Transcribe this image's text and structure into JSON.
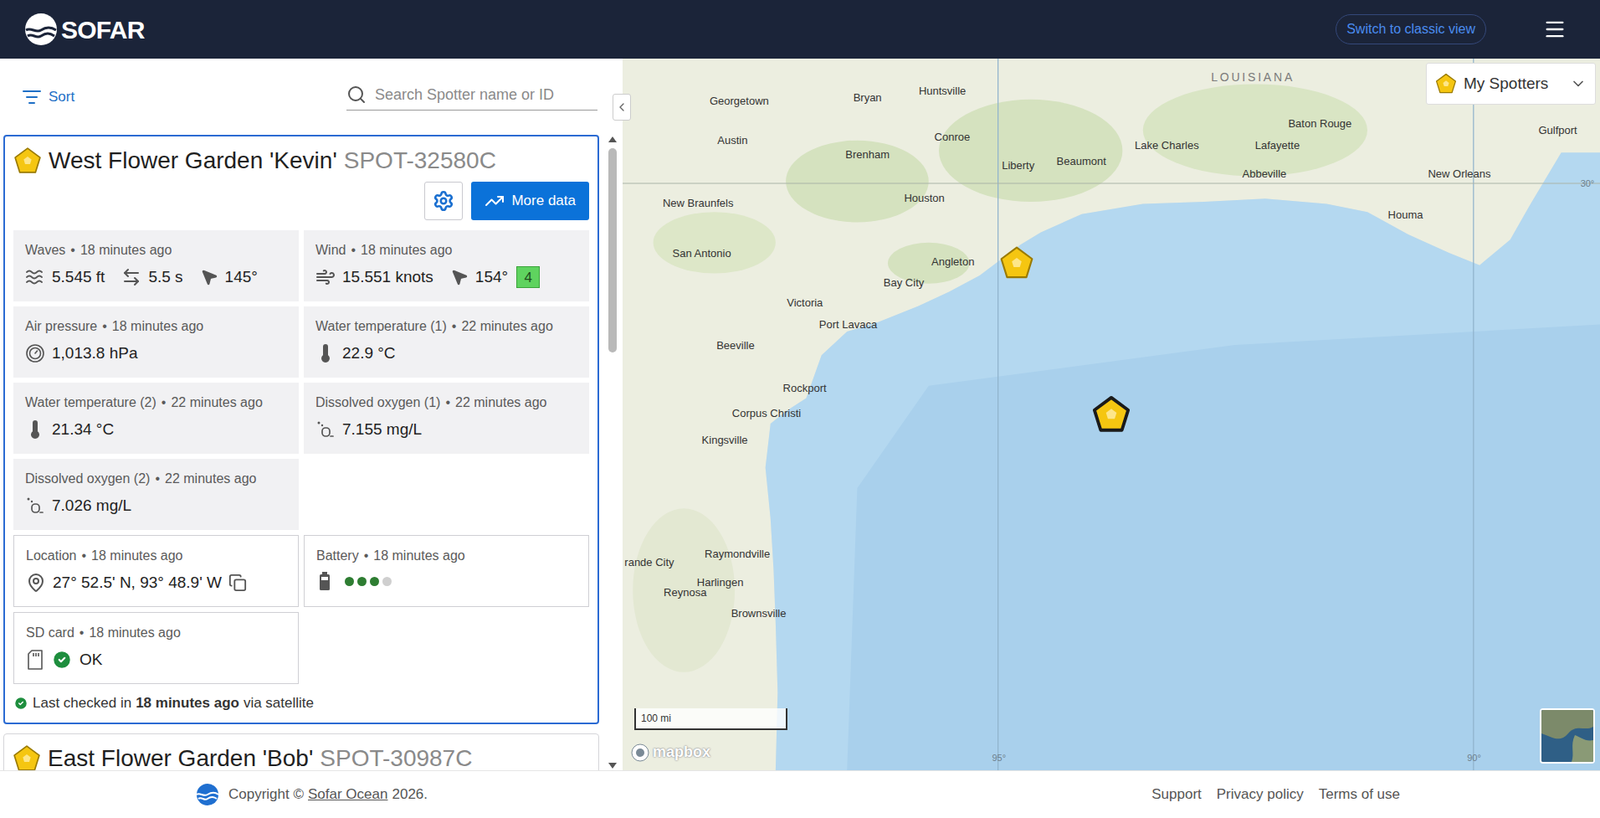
{
  "header": {
    "logo": "SOFAR",
    "switch_button": "Switch to classic view"
  },
  "toolbar": {
    "sort": "Sort",
    "search": {
      "placeholder": "Search Spotter name or ID"
    }
  },
  "separator": "•",
  "spotters": [
    {
      "name": "West Flower Garden 'Kevin'",
      "id": "SPOT-32580C",
      "selected": true,
      "more_data": "More data",
      "measurements": [
        {
          "kind": "waves",
          "label": "Waves",
          "age": "18 minutes ago",
          "values": [
            "5.545 ft",
            "5.5 s",
            "145°"
          ]
        },
        {
          "kind": "wind",
          "label": "Wind",
          "age": "18 minutes ago",
          "values": [
            "15.551 knots",
            "154°"
          ],
          "badge": {
            "text": "4",
            "color": "#5fd35f"
          }
        },
        {
          "kind": "pressure",
          "label": "Air pressure",
          "age": "18 minutes ago",
          "values": [
            "1,013.8 hPa"
          ]
        },
        {
          "kind": "temperature",
          "label": "Water temperature (1)",
          "age": "22 minutes ago",
          "values": [
            "22.9 °C"
          ]
        },
        {
          "kind": "temperature",
          "label": "Water temperature (2)",
          "age": "22 minutes ago",
          "values": [
            "21.34 °C"
          ]
        },
        {
          "kind": "oxygen",
          "label": "Dissolved oxygen (1)",
          "age": "22 minutes ago",
          "values": [
            "7.155 mg/L"
          ]
        },
        {
          "kind": "oxygen",
          "label": "Dissolved oxygen (2)",
          "age": "22 minutes ago",
          "values": [
            "7.026 mg/L"
          ]
        }
      ],
      "status": [
        {
          "kind": "location",
          "label": "Location",
          "age": "18 minutes ago",
          "values": [
            "27° 52.5' N, 93° 48.9' W"
          ]
        },
        {
          "kind": "battery",
          "label": "Battery",
          "age": "18 minutes ago",
          "level": 0.75
        },
        {
          "kind": "sd",
          "label": "SD card",
          "age": "18 minutes ago",
          "values": [
            "OK"
          ],
          "ok": true
        }
      ],
      "last_checked": {
        "prefix": "Last checked in",
        "time": "18 minutes ago",
        "suffix": "via satellite"
      }
    },
    {
      "name": "East Flower Garden 'Bob'",
      "id": "SPOT-30987C",
      "selected": false
    }
  ],
  "map": {
    "filter": {
      "label": "My Spotters"
    },
    "labels": [
      {
        "text": "LOUISIANA",
        "kind": "region"
      },
      {
        "text": "Georgetown",
        "kind": "city"
      },
      {
        "text": "Bryan",
        "kind": "city"
      },
      {
        "text": "Huntsville",
        "kind": "city"
      },
      {
        "text": "Baton Rouge",
        "kind": "city"
      },
      {
        "text": "Gulfport",
        "kind": "city"
      },
      {
        "text": "Austin",
        "kind": "city"
      },
      {
        "text": "Conroe",
        "kind": "city"
      },
      {
        "text": "Lake Charles",
        "kind": "city"
      },
      {
        "text": "Lafayette",
        "kind": "city"
      },
      {
        "text": "Brenham",
        "kind": "city"
      },
      {
        "text": "Liberty",
        "kind": "city"
      },
      {
        "text": "Beaumont",
        "kind": "city"
      },
      {
        "text": "Abbeville",
        "kind": "city"
      },
      {
        "text": "New Orleans",
        "kind": "city"
      },
      {
        "text": "Houston",
        "kind": "city"
      },
      {
        "text": "Houma",
        "kind": "city"
      },
      {
        "text": "New Braunfels",
        "kind": "city"
      },
      {
        "text": "San Antonio",
        "kind": "city"
      },
      {
        "text": "Angleton",
        "kind": "city"
      },
      {
        "text": "Bay City",
        "kind": "city"
      },
      {
        "text": "Victoria",
        "kind": "city"
      },
      {
        "text": "Port Lavaca",
        "kind": "city"
      },
      {
        "text": "Beeville",
        "kind": "city"
      },
      {
        "text": "Rockport",
        "kind": "city"
      },
      {
        "text": "Corpus Christi",
        "kind": "city"
      },
      {
        "text": "Kingsville",
        "kind": "city"
      },
      {
        "text": "Raymondville",
        "kind": "city"
      },
      {
        "text": "rande City",
        "kind": "city"
      },
      {
        "text": "Harlingen",
        "kind": "city"
      },
      {
        "text": "Reynosa",
        "kind": "city"
      },
      {
        "text": "Brownsville",
        "kind": "city"
      },
      {
        "text": "30°",
        "kind": "graticule"
      },
      {
        "text": "95°",
        "kind": "graticule"
      },
      {
        "text": "90°",
        "kind": "graticule"
      }
    ],
    "pins": [
      {
        "selected": false
      },
      {
        "selected": true
      }
    ],
    "scale": "100 mi",
    "attribution": "mapbox"
  },
  "footer": {
    "copyright": "Copyright ©",
    "company": "Sofar Ocean",
    "year": "2026.",
    "links": [
      "Support",
      "Privacy policy",
      "Terms of use"
    ]
  }
}
